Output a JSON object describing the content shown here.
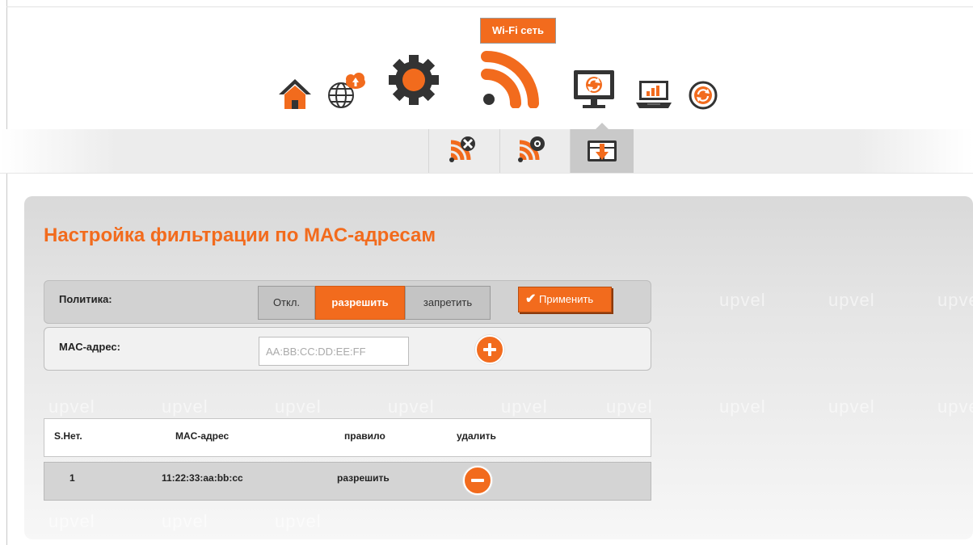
{
  "colors": {
    "accent": "#f26b1d",
    "icon_dark": "#333333"
  },
  "nav": {
    "items": [
      {
        "icon": "home-icon"
      },
      {
        "icon": "globe-cloud-icon"
      },
      {
        "icon": "gear-icon"
      },
      {
        "icon": "wifi-icon",
        "active": true,
        "tooltip": "Wi-Fi сеть"
      },
      {
        "icon": "monitor-refresh-icon"
      },
      {
        "icon": "laptop-chart-icon"
      },
      {
        "icon": "power-cycle-icon"
      }
    ]
  },
  "subnav": {
    "tabs": [
      {
        "icon": "wifi-tools-icon"
      },
      {
        "icon": "wifi-settings-icon"
      },
      {
        "icon": "mac-filter-icon",
        "active": true
      }
    ]
  },
  "page": {
    "title": "Настройка фильтрации по МАС-адресам"
  },
  "watermark": "upvel",
  "policy": {
    "label": "Политика:",
    "options": [
      "Откл.",
      "разрешить",
      "запретить"
    ],
    "selected": "разрешить",
    "apply_label": "Применить",
    "apply_check": "✔"
  },
  "mac_entry": {
    "label": "MAC-адрес:",
    "value": "",
    "placeholder": "AA:BB:CC:DD:EE:FF"
  },
  "table": {
    "headers": [
      "S.Нет.",
      "MAC-адрес",
      "правило",
      "удалить"
    ],
    "rows": [
      {
        "num": "1",
        "mac": "11:22:33:aa:bb:cc",
        "rule": "разрешить"
      }
    ]
  }
}
